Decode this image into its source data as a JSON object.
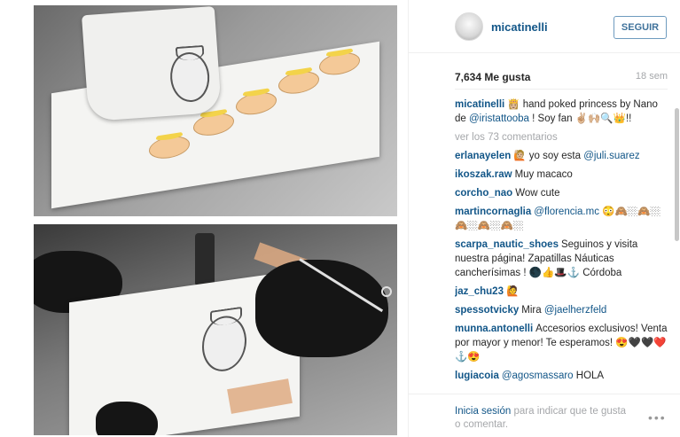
{
  "post": {
    "username": "micatinelli",
    "follow_label": "SEGUIR",
    "likes": "7,634 Me gusta",
    "age": "18 sem"
  },
  "caption": {
    "user": "micatinelli",
    "text_1": "👸🏼 hand poked princess by Nano de ",
    "mention": "@iristattooba",
    "text_2": " ! Soy fan ✌🏼🙌🏼🔍👑!!"
  },
  "view_all": "ver los 73 comentarios",
  "comments": [
    {
      "user": "erlanayelen",
      "pre": "🙋🏼 yo soy esta ",
      "mention": "@juli.suarez",
      "post": ""
    },
    {
      "user": "ikoszak.raw",
      "pre": "Muy macaco",
      "mention": "",
      "post": ""
    },
    {
      "user": "corcho_nao",
      "pre": "Wow cute",
      "mention": "",
      "post": ""
    },
    {
      "user": "martincornaglia",
      "pre": "",
      "mention": "@florencia.mc",
      "post": " 😳🙈🏼🙈🏼🙈🏼🙈🏼🙈🏼"
    },
    {
      "user": "scarpa_nautic_shoes",
      "pre": "Seguinos y visita nuestra página! Zapatillas Náuticas cancherísimas ! 🌑👍🎩⚓ Córdoba",
      "mention": "",
      "post": ""
    },
    {
      "user": "jaz_chu23",
      "pre": "🙋",
      "mention": "",
      "post": ""
    },
    {
      "user": "spessotvicky",
      "pre": "Mira ",
      "mention": "@jaelherzfeld",
      "post": ""
    },
    {
      "user": "munna.antonelli",
      "pre": "Accesorios exclusivos! Venta por mayor y menor! Te esperamos! 😍🖤🖤❤️⚓😍",
      "mention": "",
      "post": ""
    },
    {
      "user": "lugiacoia",
      "pre": "",
      "mention": "@agosmassaro",
      "post": " HOLA"
    }
  ],
  "footer": {
    "login_link": "Inicia sesión",
    "rest": " para indicar que te gusta o comentar.",
    "more": "•••"
  },
  "colors": {
    "link": "#125688",
    "muted": "#a5a7aa",
    "follow_border": "#6e9bbf"
  }
}
